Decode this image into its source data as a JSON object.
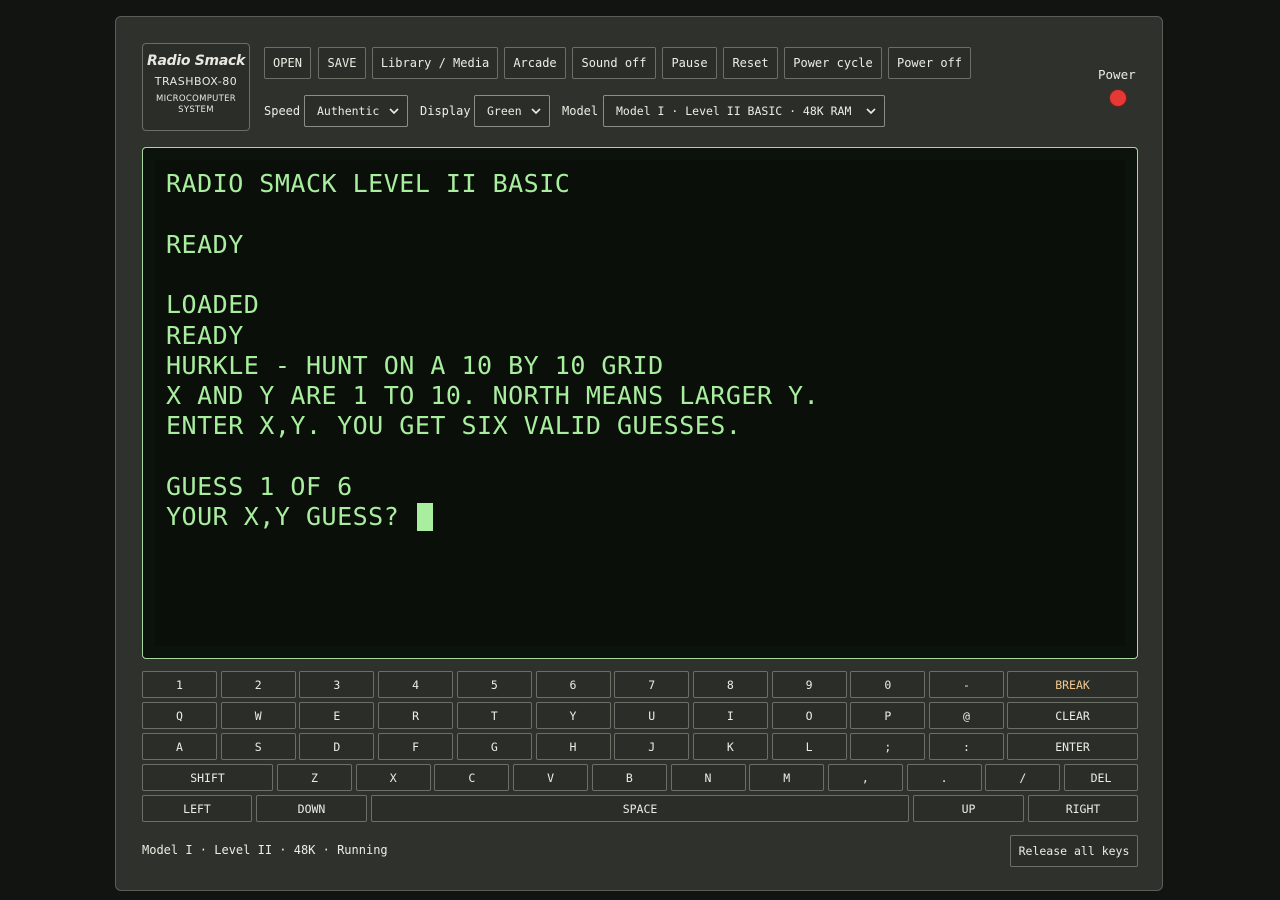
{
  "logo": {
    "brand": "Radio Smack",
    "model": "TRASHBOX-80",
    "system_line1": "MICROCOMPUTER",
    "system_line2": "SYSTEM"
  },
  "toolbar": {
    "open": "OPEN",
    "save": "SAVE",
    "library": "Library / Media",
    "arcade": "Arcade",
    "sound": "Sound off",
    "pause": "Pause",
    "reset": "Reset",
    "power_cycle": "Power cycle",
    "power_off": "Power off"
  },
  "settings": {
    "speed_label": "Speed",
    "speed_value": "Authentic",
    "display_label": "Display",
    "display_value": "Green",
    "model_label": "Model",
    "model_value": "Model I · Level II BASIC · 48K RAM"
  },
  "power": {
    "label": "Power",
    "led_color": "#e53935"
  },
  "screen": {
    "color": "#a8ee9e",
    "lines": [
      "RADIO SMACK LEVEL II BASIC",
      "",
      "READY",
      "",
      "LOADED",
      "READY",
      "HURKLE - HUNT ON A 10 BY 10 GRID",
      "X AND Y ARE 1 TO 10. NORTH MEANS LARGER Y.",
      "ENTER X,Y. YOU GET SIX VALID GUESSES.",
      "",
      "GUESS 1 OF 6",
      "YOUR X,Y GUESS? "
    ]
  },
  "keyboard": {
    "row1": [
      "1",
      "2",
      "3",
      "4",
      "5",
      "6",
      "7",
      "8",
      "9",
      "0",
      "-",
      "BREAK"
    ],
    "row2": [
      "Q",
      "W",
      "E",
      "R",
      "T",
      "Y",
      "U",
      "I",
      "O",
      "P",
      "@",
      "CLEAR"
    ],
    "row3": [
      "A",
      "S",
      "D",
      "F",
      "G",
      "H",
      "J",
      "K",
      "L",
      ";",
      ":",
      "ENTER"
    ],
    "row4": [
      "SHIFT",
      "Z",
      "X",
      "C",
      "V",
      "B",
      "N",
      "M",
      ",",
      ".",
      "/",
      "DEL"
    ],
    "row5": [
      "LEFT",
      "DOWN",
      "SPACE",
      "UP",
      "RIGHT"
    ]
  },
  "status": {
    "text": "Model I · Level II · 48K · Running",
    "release": "Release all keys"
  }
}
